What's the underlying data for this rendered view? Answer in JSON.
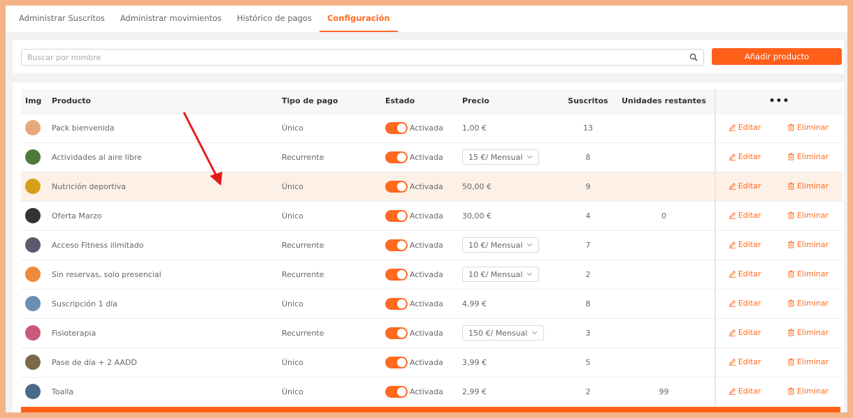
{
  "tabs": [
    {
      "label": "Administrar Suscritos",
      "active": false
    },
    {
      "label": "Administrar movimientos",
      "active": false
    },
    {
      "label": "Histórico de pagos",
      "active": false
    },
    {
      "label": "Configuración",
      "active": true
    }
  ],
  "search": {
    "placeholder": "Buscar por nombre"
  },
  "add_button": "Añadir producto",
  "columns": {
    "img": "Img",
    "product": "Producto",
    "payment_type": "Tipo de pago",
    "status": "Estado",
    "price": "Precio",
    "subscribers": "Suscritos",
    "remaining": "Unidades restantes",
    "actions": "•••"
  },
  "actions": {
    "edit": "Editar",
    "delete": "Eliminar"
  },
  "accent_color": "#ff6a1f",
  "rows": [
    {
      "name": "Pack bienvenida",
      "type": "Único",
      "status": "Activada",
      "price": "1,00 €",
      "price_select": false,
      "subs": "13",
      "remaining": "",
      "avatar": "#e8a87c"
    },
    {
      "name": "Actividades al aire libre",
      "type": "Recurrente",
      "status": "Activada",
      "price": "15 €/ Mensual",
      "price_select": true,
      "subs": "8",
      "remaining": "",
      "avatar": "#4d7a3a"
    },
    {
      "name": "Nutrición deportiva",
      "type": "Único",
      "status": "Activada",
      "price": "50,00 €",
      "price_select": false,
      "subs": "9",
      "remaining": "",
      "avatar": "#d4a017",
      "highlight": true
    },
    {
      "name": "Oferta Marzo",
      "type": "Único",
      "status": "Activada",
      "price": "30,00 €",
      "price_select": false,
      "subs": "4",
      "remaining": "0",
      "avatar": "#333333"
    },
    {
      "name": "Acceso Fitness ilimitado",
      "type": "Recurrente",
      "status": "Activada",
      "price": "10 €/ Mensual",
      "price_select": true,
      "subs": "7",
      "remaining": "",
      "avatar": "#5a5a6e"
    },
    {
      "name": "Sin reservas, solo presencial",
      "type": "Recurrente",
      "status": "Activada",
      "price": "10 €/ Mensual",
      "price_select": true,
      "subs": "2",
      "remaining": "",
      "avatar": "#f08a3c"
    },
    {
      "name": "Suscripción 1 día",
      "type": "Único",
      "status": "Activada",
      "price": "4,99 €",
      "price_select": false,
      "subs": "8",
      "remaining": "",
      "avatar": "#6a8fb0"
    },
    {
      "name": "Fisioterapia",
      "type": "Recurrente",
      "status": "Activada",
      "price": "150 €/ Mensual",
      "price_select": true,
      "subs": "3",
      "remaining": "",
      "avatar": "#c95a7a"
    },
    {
      "name": "Pase de día + 2 AADD",
      "type": "Único",
      "status": "Activada",
      "price": "3,99 €",
      "price_select": false,
      "subs": "5",
      "remaining": "",
      "avatar": "#7a6a4a"
    },
    {
      "name": "Toalla",
      "type": "Único",
      "status": "Activada",
      "price": "2,99 €",
      "price_select": false,
      "subs": "2",
      "remaining": "99",
      "avatar": "#4a6a8a"
    }
  ]
}
